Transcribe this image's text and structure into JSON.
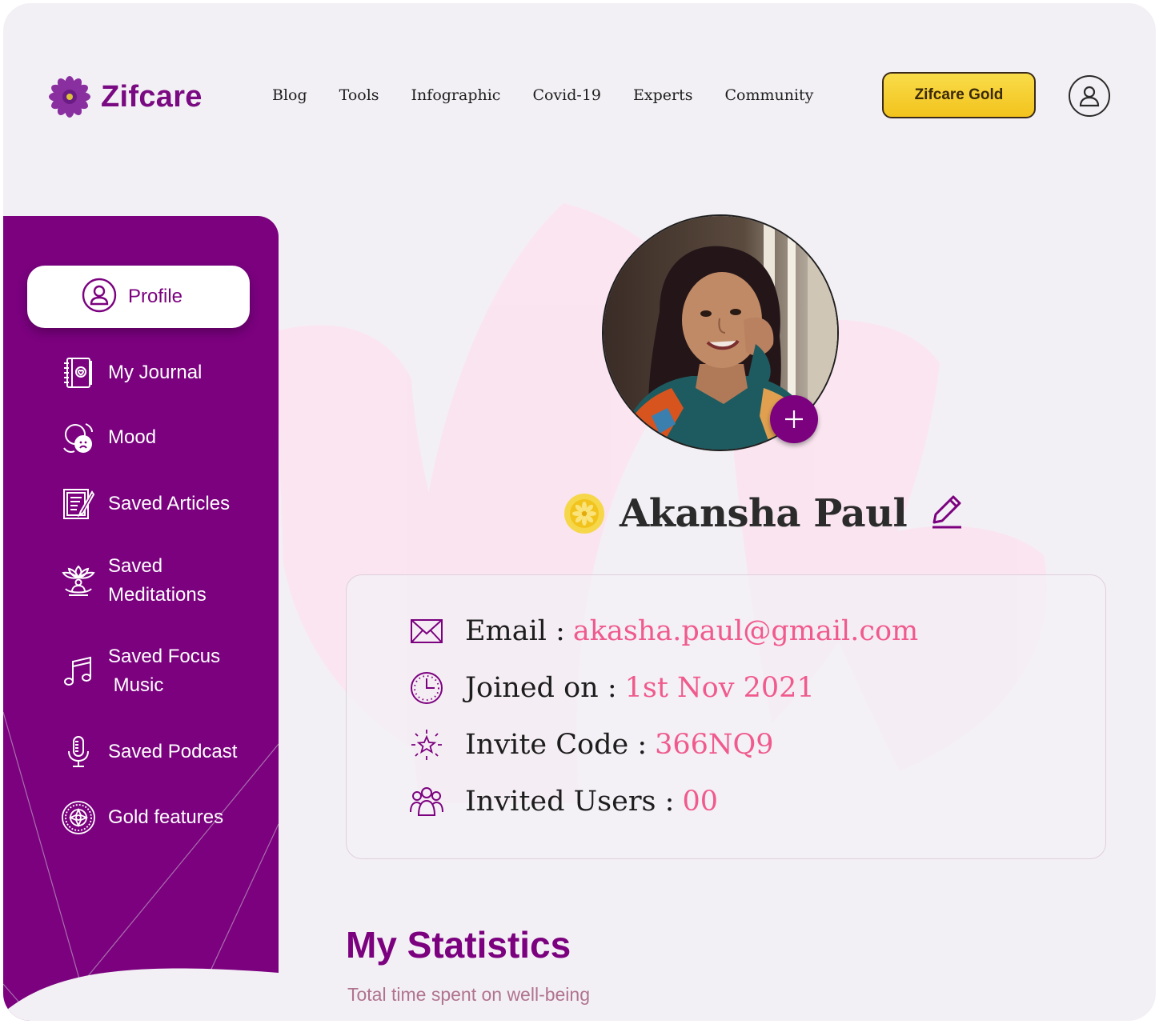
{
  "brand": {
    "name": "Zifcare"
  },
  "nav": {
    "links": [
      "Blog",
      "Tools",
      "Infographic",
      "Covid-19",
      "Experts",
      "Community"
    ],
    "gold_button": "Zifcare Gold"
  },
  "sidebar": {
    "items": [
      {
        "label": "Profile",
        "icon": "profile-icon",
        "active": true
      },
      {
        "label": "My Journal",
        "icon": "journal-icon"
      },
      {
        "label": "Mood",
        "icon": "mood-icon"
      },
      {
        "label": "Saved Articles",
        "icon": "article-icon"
      },
      {
        "label": "Saved\nMeditations",
        "icon": "meditation-icon"
      },
      {
        "label": "Saved Focus\n Music",
        "icon": "music-icon"
      },
      {
        "label": "Saved Podcast",
        "icon": "microphone-icon"
      },
      {
        "label": "Gold features",
        "icon": "gold-badge-icon"
      }
    ]
  },
  "profile": {
    "name": "Akansha Paul",
    "fields": [
      {
        "label": "Email :",
        "value": "akasha.paul@gmail.com",
        "icon": "mail-icon"
      },
      {
        "label": "Joined on :",
        "value": "1st Nov 2021",
        "icon": "clock-icon"
      },
      {
        "label": "Invite Code :",
        "value": "366NQ9",
        "icon": "star-icon"
      },
      {
        "label": "Invited Users :",
        "value": "00",
        "icon": "users-icon"
      }
    ]
  },
  "stats": {
    "title": "My Statistics",
    "subtitle": "Total time spent on well-being"
  },
  "colors": {
    "brand_purple": "#7b017f",
    "accent_pink": "#f05a8c",
    "gold": "#f2c31c",
    "background": "#f3f0f5"
  }
}
